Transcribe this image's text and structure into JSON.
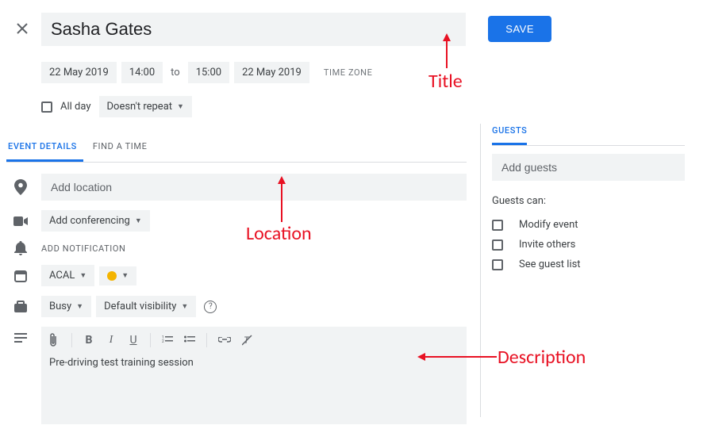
{
  "header": {
    "title_value": "Sasha Gates",
    "save_label": "SAVE"
  },
  "datetime": {
    "start_date": "22 May 2019",
    "start_time": "14:00",
    "to_label": "to",
    "end_time": "15:00",
    "end_date": "22 May 2019",
    "timezone_label": "TIME ZONE"
  },
  "options": {
    "all_day_label": "All day",
    "repeat_label": "Doesn't repeat"
  },
  "tabs": {
    "event_details": "EVENT DETAILS",
    "find_a_time": "FIND A TIME"
  },
  "details": {
    "location_placeholder": "Add location",
    "conferencing_label": "Add conferencing",
    "notification_label": "ADD NOTIFICATION",
    "calendar_label": "ACAL",
    "availability_label": "Busy",
    "visibility_label": "Default visibility"
  },
  "description": {
    "text": "Pre-driving test training session"
  },
  "guests": {
    "tab_label": "GUESTS",
    "input_placeholder": "Add guests",
    "can_label": "Guests can:",
    "permissions": {
      "modify": "Modify event",
      "invite": "Invite others",
      "see_list": "See guest list"
    }
  },
  "annotations": {
    "title": "Title",
    "location": "Location",
    "description": "Description"
  }
}
